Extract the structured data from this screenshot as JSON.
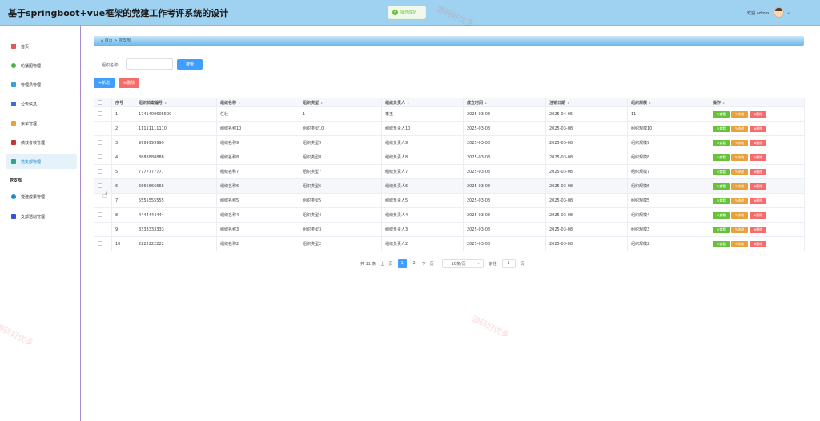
{
  "header": {
    "title": "基于springboot+vue框架的党建工作考评系统的设计",
    "toast": "操作成功",
    "welcome": "欢迎 admin"
  },
  "sidebar": {
    "items": [
      {
        "label": "首页",
        "icon": "home-icon",
        "color": "#e15a5a"
      },
      {
        "label": "轮播图管理",
        "icon": "carousel-icon",
        "color": "#4cae4c"
      },
      {
        "label": "管理员管理",
        "icon": "admin-icon",
        "color": "#3a9fd8"
      },
      {
        "label": "公告信息",
        "icon": "notice-icon",
        "color": "#3a6fd8"
      },
      {
        "label": "菜单管理",
        "icon": "menu-icon",
        "color": "#e6a23c"
      },
      {
        "label": "绩效考核管理",
        "icon": "assessment-icon",
        "color": "#c0392b"
      },
      {
        "label": "党支部管理",
        "icon": "branch-icon",
        "color": "#2ca58d"
      }
    ],
    "group_label": "党支部",
    "group_items": [
      {
        "label": "党建成果管理",
        "icon": "result-icon",
        "color": "#1c8dd0"
      },
      {
        "label": "支部活动管理",
        "icon": "activity-icon",
        "color": "#3a4fd8"
      }
    ]
  },
  "breadcrumb": {
    "home": "首页",
    "sep": ">",
    "current": "党支部"
  },
  "search": {
    "label": "组织名称:",
    "value": "",
    "button": "搜索"
  },
  "toolbar": {
    "add": "+新增",
    "delete": "删除"
  },
  "table": {
    "headers": [
      "序号",
      "组织档案编号",
      "组织名称",
      "组织类型",
      "组织负责人",
      "成立时间",
      "注销日期",
      "组织规模",
      "操作"
    ],
    "rows": [
      [
        "1",
        "1741400605500",
        "任壮",
        "1",
        "李玉",
        "2025-03-08",
        "2025-04-05",
        "11"
      ],
      [
        "2",
        "11111111110",
        "组织名称10",
        "组织类型10",
        "组织负责人10",
        "2025-03-08",
        "2025-03-08",
        "组织规模10"
      ],
      [
        "3",
        "9999999999",
        "组织名称9",
        "组织类型9",
        "组织负责人9",
        "2025-03-08",
        "2025-03-08",
        "组织规模9"
      ],
      [
        "4",
        "8888888888",
        "组织名称8",
        "组织类型8",
        "组织负责人8",
        "2025-03-08",
        "2025-03-08",
        "组织规模8"
      ],
      [
        "5",
        "7777777777",
        "组织名称7",
        "组织类型7",
        "组织负责人7",
        "2025-03-08",
        "2025-03-08",
        "组织规模7"
      ],
      [
        "6",
        "6666666666",
        "组织名称6",
        "组织类型6",
        "组织负责人6",
        "2025-03-08",
        "2025-03-08",
        "组织规模6"
      ],
      [
        "7",
        "5555555555",
        "组织名称5",
        "组织类型5",
        "组织负责人5",
        "2025-03-08",
        "2025-03-08",
        "组织规模5"
      ],
      [
        "8",
        "4444444444",
        "组织名称4",
        "组织类型4",
        "组织负责人4",
        "2025-03-08",
        "2025-03-08",
        "组织规模4"
      ],
      [
        "9",
        "3333333333",
        "组织名称3",
        "组织类型3",
        "组织负责人3",
        "2025-03-08",
        "2025-03-08",
        "组织规模3"
      ],
      [
        "10",
        "2222222222",
        "组织名称2",
        "组织类型2",
        "组织负责人2",
        "2025-03-08",
        "2025-03-08",
        "组织规模2"
      ]
    ],
    "actions": {
      "view": "查看",
      "edit": "修改",
      "delete": "删除"
    }
  },
  "pager": {
    "total": "共 11 条",
    "prev": "上一页",
    "pages": [
      "1",
      "2"
    ],
    "current": "1",
    "next": "下一页",
    "page_size": "10条/页",
    "goto_label": "前往",
    "goto_value": "1",
    "page_unit": "页"
  },
  "watermark": "源码好优多",
  "colors": {
    "primary": "#409eff",
    "success": "#67c23a",
    "warning": "#e6a23c",
    "danger": "#f56c6c",
    "header": "#9fd1f0"
  }
}
